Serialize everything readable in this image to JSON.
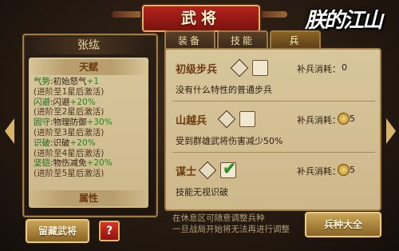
{
  "header": {
    "title": "武将",
    "logo_text": "朕的江山"
  },
  "hero": {
    "name": "张纮",
    "talent_header": "天赋",
    "attribute_header": "属性",
    "talents": [
      {
        "name": "气势",
        "effect": "初始怒气",
        "value": "+1"
      },
      {
        "cond": "(进阶至1星后激活)"
      },
      {
        "name": "闪避",
        "effect": "闪避",
        "value": "+20%"
      },
      {
        "cond": "(进阶至2星后激活)"
      },
      {
        "name": "固守",
        "effect": "物理防御",
        "value": "+30%"
      },
      {
        "cond": "(进阶至3星后激活)"
      },
      {
        "name": "识破",
        "effect": "识破",
        "value": "+20%"
      },
      {
        "cond": "(进阶至4星后激活)"
      },
      {
        "name": "坚铠",
        "effect": "物伤减免",
        "value": "+20%"
      },
      {
        "cond": "(进阶至5星后激活)"
      }
    ]
  },
  "buttons": {
    "collect": "留藏武将",
    "help": "?",
    "troop_guide": "兵种大全"
  },
  "tabs": [
    "装备",
    "技能",
    "兵"
  ],
  "troops": [
    {
      "name": "初级步兵",
      "cost_label": "补兵消耗：",
      "cost": "0",
      "has_coin": false,
      "checked": false,
      "desc": "没有什么特性的普通步兵"
    },
    {
      "name": "山越兵",
      "cost_label": "补兵消耗：",
      "cost": "5",
      "has_coin": true,
      "checked": false,
      "desc": "受到群雄武将伤害减少50%"
    },
    {
      "name": "谋士",
      "cost_label": "补兵消耗：",
      "cost": "5",
      "has_coin": true,
      "checked": true,
      "desc": "技能无视识破"
    }
  ],
  "hints": [
    "在休息区可随意调整兵种",
    "一旦战局开始将无法再进行调整"
  ],
  "colors": {
    "accent_gold": "#d9b56a",
    "title_red": "#b3241c",
    "talent_green": "#1a8a1a"
  }
}
